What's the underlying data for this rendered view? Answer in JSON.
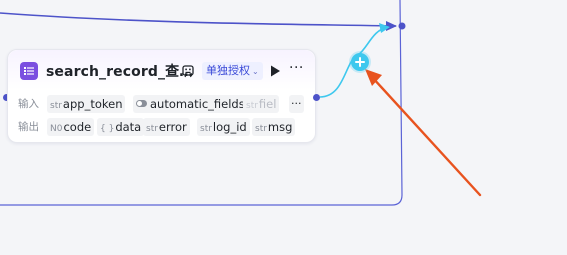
{
  "node": {
    "title": "search_record_查…",
    "auth_label": "单独授权",
    "inputs": {
      "label": "输入",
      "params": [
        {
          "type": "str",
          "name": "app_token"
        },
        {
          "type": "toggle",
          "name": "automatic_fields"
        },
        {
          "type": "str",
          "name": "fiel"
        }
      ]
    },
    "outputs": {
      "label": "输出",
      "params": [
        {
          "type": "N0",
          "name": "code"
        },
        {
          "type": "{ }",
          "name": "data"
        },
        {
          "type": "str",
          "name": "error"
        },
        {
          "type": "str",
          "name": "log_id"
        },
        {
          "type": "str",
          "name": "msg"
        }
      ]
    },
    "more_glyph": "···",
    "inline_more_glyph": "···"
  },
  "colors": {
    "accent": "#4d53c9",
    "connector": "#3ec8ee",
    "annotation_arrow": "#e8531f",
    "node_icon": "#7b4fe0"
  },
  "icons": {
    "node_icon": "list-icon",
    "debug": "debug-icon",
    "run": "play-icon",
    "add": "plus-icon"
  }
}
